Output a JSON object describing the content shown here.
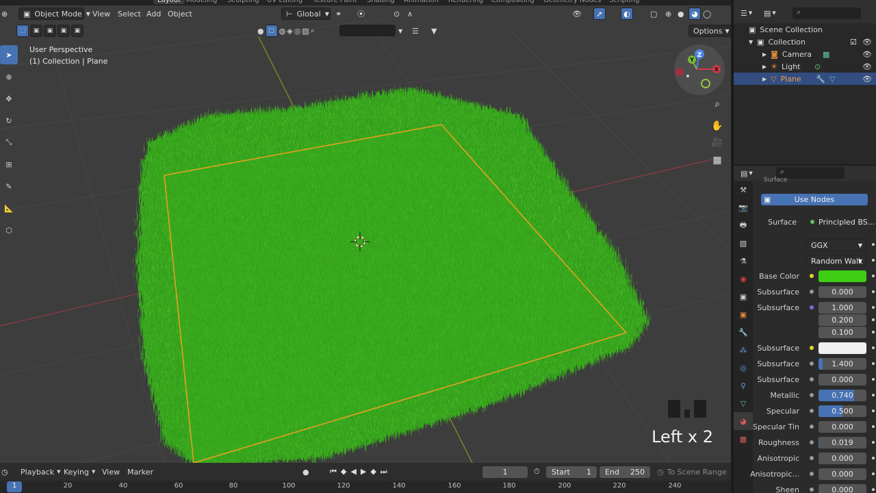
{
  "workspace_tabs": [
    "Layout",
    "Modeling",
    "Sculpting",
    "UV Editing",
    "Texture Paint",
    "Shading",
    "Animation",
    "Rendering",
    "Compositing",
    "Geometry Nodes",
    "Scripting"
  ],
  "workspace_active": "Layout",
  "header": {
    "mode": "Object Mode",
    "menus": [
      "View",
      "Select",
      "Add",
      "Object"
    ],
    "orientation": "Global",
    "options_label": "Options"
  },
  "overlay": {
    "perspective": "User Perspective",
    "collection": "(1) Collection | Plane"
  },
  "gizmo_axes": [
    "Z",
    "Y",
    "X"
  ],
  "keystroke_display": "Left x 2",
  "outliner": {
    "root": "Scene Collection",
    "items": [
      {
        "label": "Collection",
        "icon": "collection-icon",
        "selected": false
      },
      {
        "label": "Camera",
        "icon": "camera-icon",
        "selected": false
      },
      {
        "label": "Light",
        "icon": "light-icon",
        "selected": false
      },
      {
        "label": "Plane",
        "icon": "mesh-icon",
        "selected": true
      }
    ]
  },
  "properties": {
    "section_partial": "Surface",
    "use_nodes": "Use Nodes",
    "surface_label": "Surface",
    "surface_value": "Principled BS...",
    "distribution": "GGX",
    "subsurface_method": "Random Walk",
    "rows": [
      {
        "label": "Base Color",
        "value": "",
        "type": "color",
        "color": "#3ecf13",
        "dot": "#d8d830"
      },
      {
        "label": "Subsurface",
        "value": "0.000",
        "type": "num",
        "fill": 0
      },
      {
        "label": "Subsurface",
        "value": "1.000",
        "type": "num",
        "fill": 0,
        "dot": "#7b6be0"
      },
      {
        "label": "",
        "value": "0.200",
        "type": "num",
        "fill": 0
      },
      {
        "label": "",
        "value": "0.100",
        "type": "num",
        "fill": 0
      },
      {
        "label": "Subsurface",
        "value": "",
        "type": "color",
        "color": "#f0f0f0",
        "dot": "#d8d830"
      },
      {
        "label": "Subsurface",
        "value": "1.400",
        "type": "num",
        "fill": 0.08
      },
      {
        "label": "Subsurface",
        "value": "0.000",
        "type": "num",
        "fill": 0
      },
      {
        "label": "Metallic",
        "value": "0.740",
        "type": "num",
        "fill": 0.74
      },
      {
        "label": "Specular",
        "value": "0.500",
        "type": "num",
        "fill": 0.5
      },
      {
        "label": "Specular Tin",
        "value": "0.000",
        "type": "num",
        "fill": 0
      },
      {
        "label": "Roughness",
        "value": "0.019",
        "type": "num",
        "fill": 0.019
      },
      {
        "label": "Anisotropic",
        "value": "0.000",
        "type": "num",
        "fill": 0
      },
      {
        "label": "Anisotropic...",
        "value": "0.000",
        "type": "num",
        "fill": 0
      },
      {
        "label": "Sheen",
        "value": "0.000",
        "type": "num",
        "fill": 0
      }
    ]
  },
  "timeline": {
    "menus": [
      "Playback",
      "Keying",
      "View",
      "Marker"
    ],
    "current_frame": "1",
    "start_label": "Start",
    "start_value": "1",
    "end_label": "End",
    "end_value": "250",
    "range_label": "To Scene Range",
    "ruler": [
      "1",
      "20",
      "40",
      "60",
      "80",
      "100",
      "120",
      "140",
      "160",
      "180",
      "200",
      "220",
      "240"
    ]
  },
  "colors": {
    "accent": "#4772b3",
    "grass": "#3cb521",
    "selection_outline": "#e8a020"
  }
}
